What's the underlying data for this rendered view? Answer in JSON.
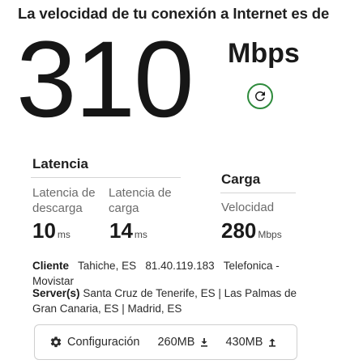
{
  "header": {
    "title": "La velocidad de tu conexión a Internet es de"
  },
  "result": {
    "speed_value": "310",
    "speed_unit": "Mbps"
  },
  "latency": {
    "title": "Latencia",
    "unloaded": {
      "label": "Latencia de descarga",
      "value": "10",
      "unit": "ms"
    },
    "loaded": {
      "label": "Latencia de carga",
      "value": "14",
      "unit": "ms"
    }
  },
  "upload": {
    "title": "Carga",
    "label": "Velocidad",
    "value": "280",
    "unit": "Mbps"
  },
  "info": {
    "client_label": "Cliente",
    "client_location": "Tahiche, ES",
    "client_ip": "81.40.119.183",
    "client_isp": "Telefonica - Movistar",
    "servers_label": "Server(s)",
    "servers_value": "Santa Cruz de Tenerife, ES  |  Las Palmas de Gran Canaria, ES  |  Madrid, ES"
  },
  "settings": {
    "label": "Configuración",
    "download_data": "260MB",
    "upload_data": "430MB"
  },
  "colors": {
    "accent": "#2e8b3c",
    "text": "#1f1f1f",
    "muted": "#6b6b6b",
    "rule": "#d4d4d4"
  },
  "icons": {
    "refresh": "refresh-icon",
    "gear": "gear-icon",
    "download": "download-icon",
    "upload": "upload-icon"
  }
}
